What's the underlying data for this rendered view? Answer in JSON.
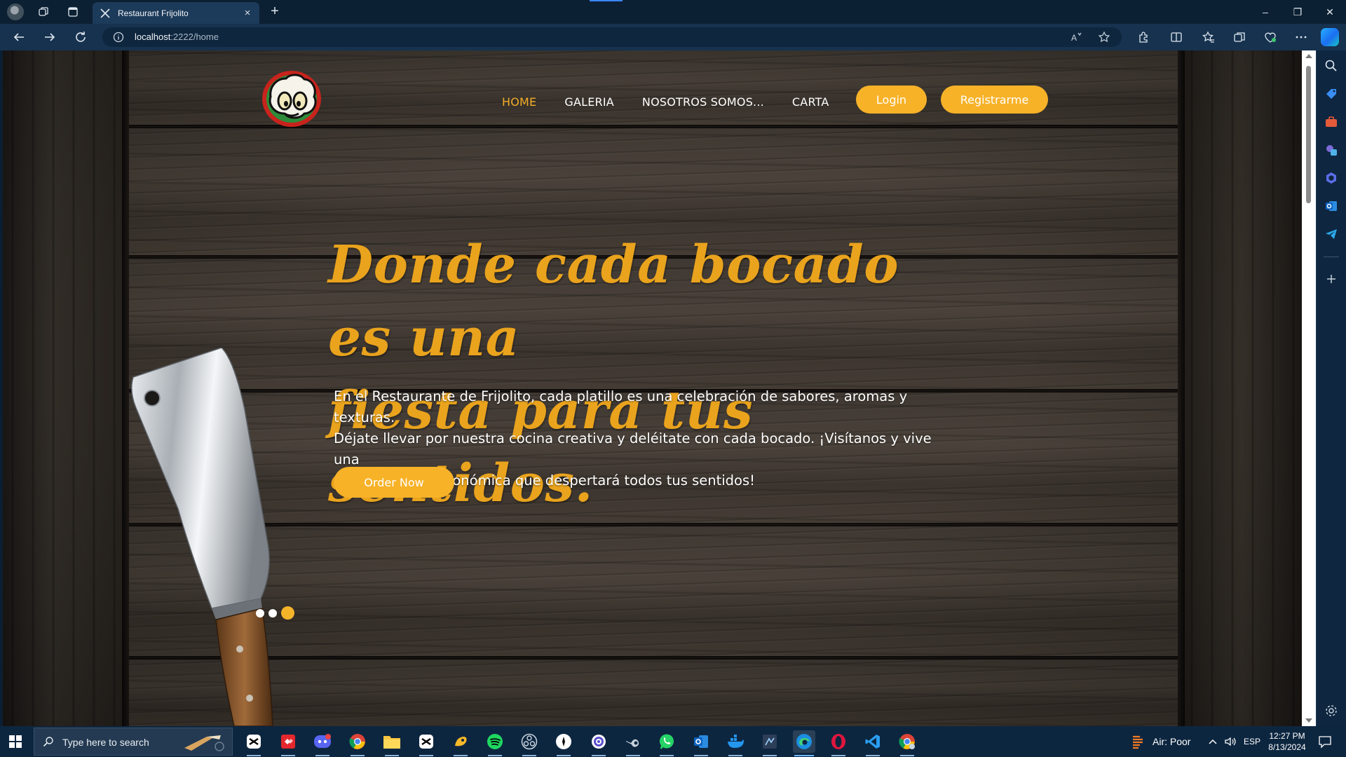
{
  "browser": {
    "tab_title": "Restaurant Frijolito",
    "url_host": "localhost",
    "url_rest": ":2222/home",
    "close_glyph": "×",
    "newtab_glyph": "+",
    "window_controls": [
      "–",
      "❐",
      "✕"
    ]
  },
  "site": {
    "nav": [
      "HOME",
      "GALERIA",
      "NOSOTROS SOMOS...",
      "CARTA"
    ],
    "active_nav": "HOME",
    "login_label": "Login",
    "register_label": "Registrarme"
  },
  "hero": {
    "title_line1": "Donde cada bocado es una",
    "title_line2": "fiesta para tus sentidos.",
    "text_line1": "En el Restaurante de Frijolito, cada platillo es una celebración de sabores, aromas y texturas.",
    "text_line2": "Déjate llevar por nuestra cocina creativa y deléitate con cada bocado. ¡Visítanos y vive una",
    "text_line3": "experiencia gastronómica que despertará todos tus sentidos!",
    "order_label": "Order Now",
    "slides_count": 3,
    "active_slide": 3
  },
  "taskbar": {
    "search_placeholder": "Type here to search",
    "weather": "Air: Poor",
    "language": "ESP",
    "time": "12:27 PM",
    "date": "8/13/2024"
  },
  "colors": {
    "accent": "#f7b228",
    "title_gold": "#e9a31d",
    "chrome_dark": "#0c2033"
  },
  "icons": {
    "browser_left": [
      "profile-avatar-icon",
      "workspaces-icon",
      "tab-actions-icon"
    ],
    "nav": [
      "back-arrow-icon",
      "forward-arrow-icon",
      "refresh-icon",
      "site-info-icon"
    ],
    "toolbar": [
      "read-aloud-icon",
      "favorite-star-icon",
      "extensions-icon",
      "split-screen-icon",
      "favorites-icon",
      "collections-icon",
      "browser-essentials-icon",
      "more-icon",
      "copilot-icon"
    ],
    "sidebar": [
      "search-icon",
      "shopping-tag-icon",
      "tools-briefcase-icon",
      "games-icon",
      "copilot-sidebar-icon",
      "outlook-icon",
      "telegram-icon",
      "add-icon",
      "settings-icon"
    ],
    "taskbar_apps": [
      "capcut-icon",
      "anydesk-icon",
      "discord-icon",
      "chrome-icon",
      "file-explorer-icon",
      "capcut2-icon",
      "sunlogin-icon",
      "spotify-icon",
      "obs-icon",
      "notion-icon",
      "app-ring-icon",
      "steam-icon",
      "whatsapp-icon",
      "outlook-icon",
      "docker-icon",
      "visual-studio-icon",
      "edge-icon",
      "opera-icon",
      "vscode-icon",
      "chrome-profile-icon"
    ]
  }
}
